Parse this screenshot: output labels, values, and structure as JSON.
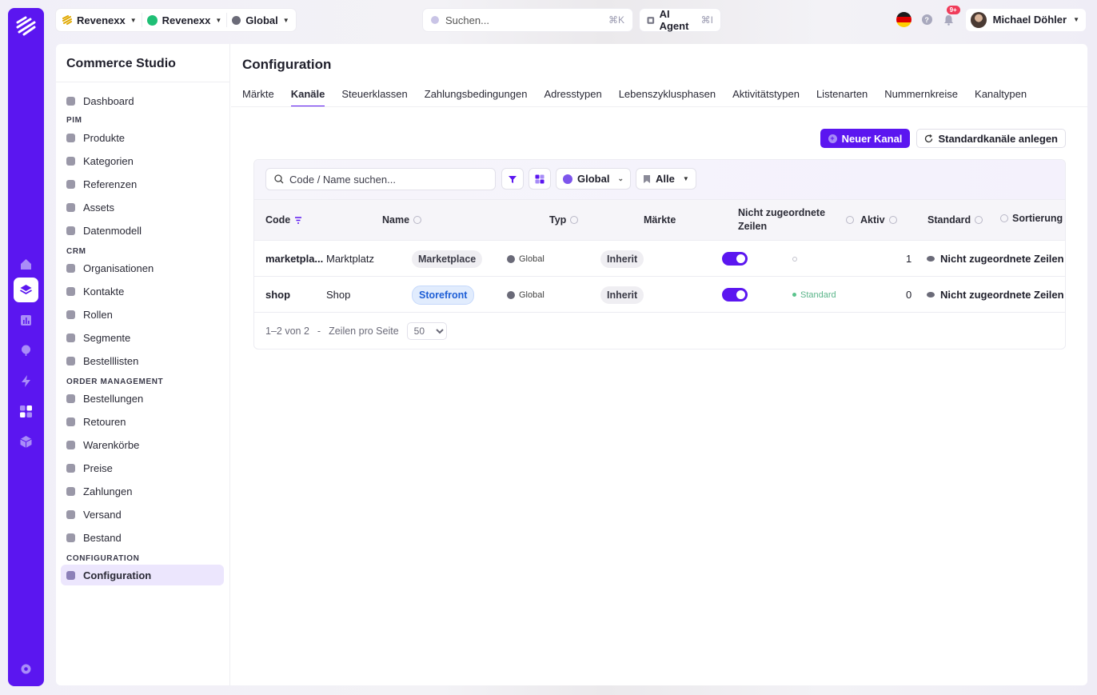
{
  "topbar": {
    "crumbs": [
      {
        "label": "Revenexx",
        "icon": "brand-icon"
      },
      {
        "label": "Revenexx",
        "icon": "green-dot-icon"
      },
      {
        "label": "Global",
        "icon": "globe-icon"
      }
    ],
    "search_placeholder": "Suchen...",
    "search_shortcut": "⌘K",
    "agent_label": "AI Agent",
    "agent_shortcut": "⌘I",
    "notification_count": "9+",
    "user_name": "Michael Döhler"
  },
  "sidebar": {
    "title": "Commerce Studio",
    "dashboard": "Dashboard",
    "sections": [
      {
        "title": "PIM",
        "items": [
          "Produkte",
          "Kategorien",
          "Referenzen",
          "Assets",
          "Datenmodell"
        ]
      },
      {
        "title": "CRM",
        "items": [
          "Organisationen",
          "Kontakte",
          "Rollen",
          "Segmente",
          "Bestelllisten"
        ]
      },
      {
        "title": "ORDER MANAGEMENT",
        "items": [
          "Bestellungen",
          "Retouren",
          "Warenkörbe",
          "Preise",
          "Zahlungen",
          "Versand",
          "Bestand"
        ]
      },
      {
        "title": "CONFIGURATION",
        "items": [
          "Configuration"
        ]
      }
    ]
  },
  "main": {
    "title": "Configuration",
    "tabs": [
      "Märkte",
      "Kanäle",
      "Steuerklassen",
      "Zahlungsbedingungen",
      "Adresstypen",
      "Lebenszyklusphasen",
      "Aktivitätstypen",
      "Listenarten",
      "Nummernkreise",
      "Kanaltypen"
    ],
    "active_tab": "Kanäle",
    "new_button": "Neuer Kanal",
    "defaults_button": "Standardkanäle anlegen"
  },
  "filters": {
    "search_placeholder": "Code / Name suchen...",
    "scope": "Global",
    "status": "Alle"
  },
  "table": {
    "columns": {
      "code": "Code",
      "name": "Name",
      "typ": "Typ",
      "maerkte": "Märkte",
      "nicht_zugeordnet": "Nicht zugeordnete Zeilen",
      "aktiv": "Aktiv",
      "standard": "Standard",
      "sortierung": "Sortierung"
    },
    "rows": [
      {
        "code": "marketpla...",
        "name": "Marktplatz",
        "typ": "Marketplace",
        "typ_color": "grey",
        "market": "Global",
        "inherit": "Inherit",
        "aktiv": true,
        "standard": "",
        "sort": "1",
        "unassigned": "Nicht zugeordnete Zeilen"
      },
      {
        "code": "shop",
        "name": "Shop",
        "typ": "Storefront",
        "typ_color": "blue",
        "market": "Global",
        "inherit": "Inherit",
        "aktiv": true,
        "standard": "Standard",
        "sort": "0",
        "unassigned": "Nicht zugeordnete Zeilen"
      }
    ]
  },
  "pager": {
    "range": "1–2 von 2",
    "separator": "-",
    "rows_label": "Zeilen pro Seite",
    "rows_value": "50"
  },
  "colors": {
    "accent": "#5b16f0",
    "rail": "#5b16f0",
    "standard_green": "#5bc48d"
  }
}
